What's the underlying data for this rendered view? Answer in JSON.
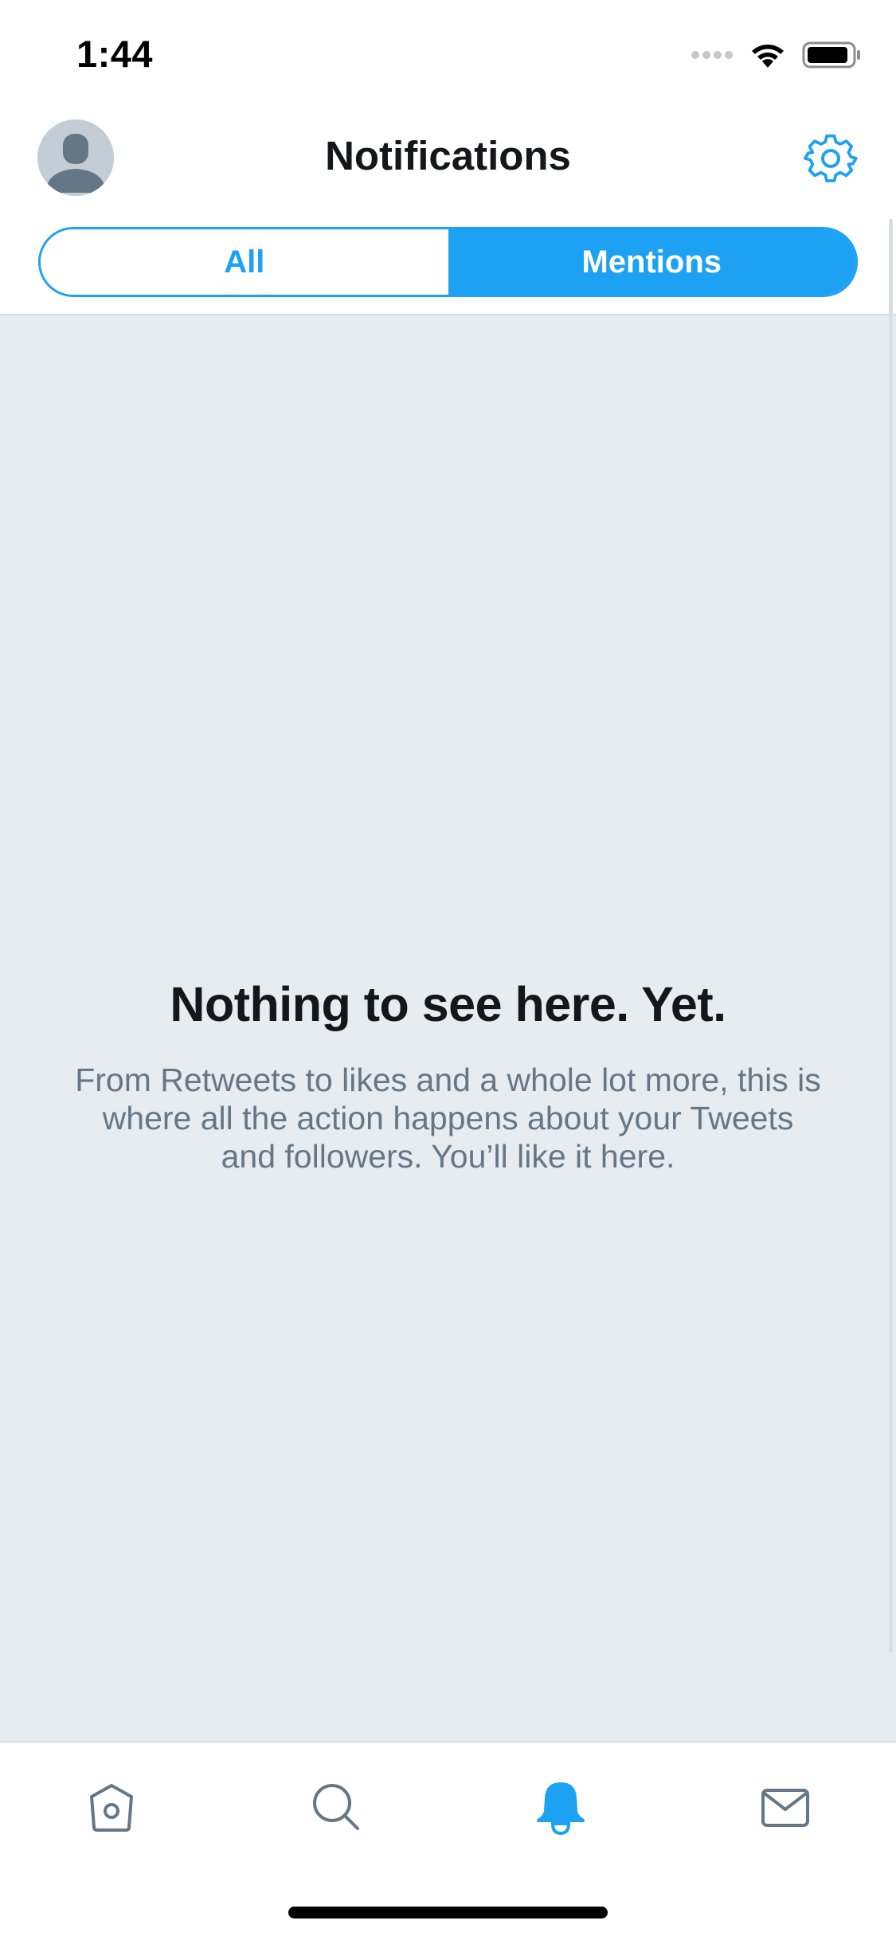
{
  "status_bar": {
    "time": "1:44",
    "signal_icon": "signal-dots-icon",
    "wifi_icon": "wifi-icon",
    "battery_icon": "battery-icon"
  },
  "header": {
    "title": "Notifications",
    "avatar_icon": "default-avatar-icon",
    "settings_icon": "gear-icon"
  },
  "tabs": {
    "all_label": "All",
    "mentions_label": "Mentions",
    "selected": "Mentions"
  },
  "empty_state": {
    "title": "Nothing to see here. Yet.",
    "body": "From Retweets to likes and a whole lot more, this is where all the action happens about your Tweets and followers. You’ll like it here."
  },
  "tab_bar": {
    "items": [
      {
        "icon": "home-icon",
        "active": false
      },
      {
        "icon": "search-icon",
        "active": false
      },
      {
        "icon": "bell-icon",
        "active": true
      },
      {
        "icon": "mail-icon",
        "active": false
      }
    ]
  },
  "colors": {
    "accent": "#1DA1F2",
    "text_primary": "#14171A",
    "text_secondary": "#657786",
    "background_empty": "#E6ECF0",
    "icon_inactive": "#657786"
  }
}
